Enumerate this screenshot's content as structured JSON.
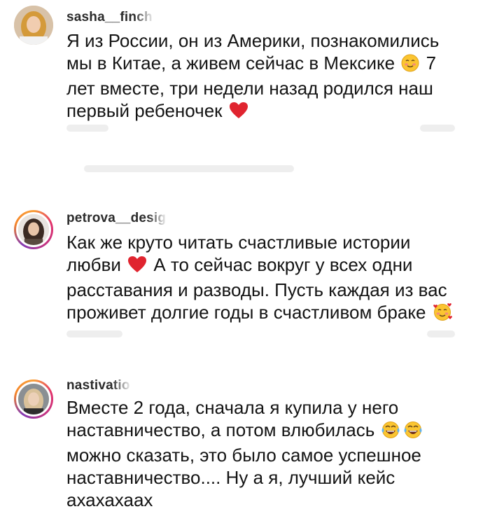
{
  "comments": [
    {
      "username": "sasha__finch",
      "text_parts": [
        "Я из России, он из Америки, познакомились мы в Китае, а живем сейчас в Мексике ",
        " 7 лет вместе, три недели назад родился наш первый ребеночек "
      ],
      "emojis": [
        "smiling-blush-emoji",
        "red-heart-emoji"
      ]
    },
    {
      "username": "petrova__desig",
      "text_parts": [
        "Как же круто читать счастливые истории любви ",
        " А то сейчас вокруг у всех одни расставания и разводы. Пусть каждая из вас проживет долгие годы в счастливом браке "
      ],
      "emojis": [
        "red-heart-emoji",
        "smiling-face-with-hearts-emoji"
      ]
    },
    {
      "username": "nastivatio",
      "text_parts": [
        "Вместе 2 года, сначала я купила у него наставничество, а потом влюбилась ",
        " можно сказать, это было самое успешное наставничество.... Ну а я, лучший кейс ахахахаах"
      ],
      "emojis": [
        "tears-of-joy-emoji",
        "tears-of-joy-emoji"
      ]
    }
  ],
  "colors": {
    "background": "#ffffff",
    "text": "#141414",
    "username": "#2b2b2b",
    "heart": "#e0242f",
    "emoji_yellow": "#fbc531"
  }
}
